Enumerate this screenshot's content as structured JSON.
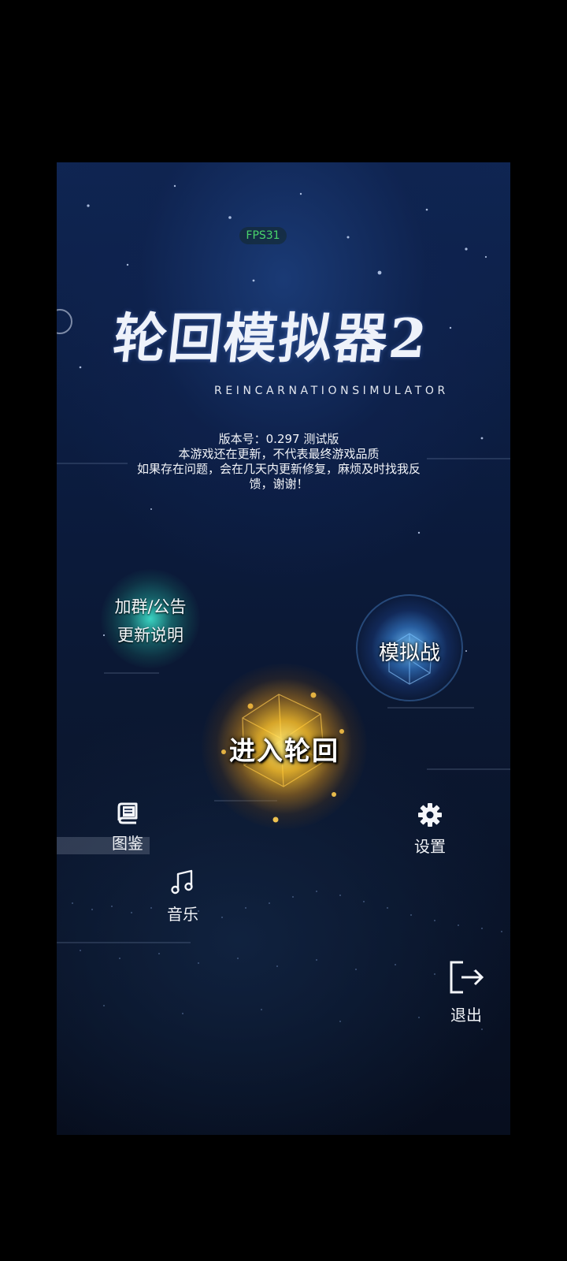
{
  "hud": {
    "fps": "FPS31"
  },
  "logo": {
    "title_cn": "轮回模拟器2",
    "title_en": "REINCARNATIONSIMULATOR"
  },
  "notice": {
    "version": "版本号：0.297 测试版",
    "line1": "本游戏还在更新，不代表最终游戏品质",
    "line2": "如果存在问题，会在几天内更新修复，麻烦及时找我反",
    "line3": "馈，谢谢！"
  },
  "menu": {
    "announce_line1": "加群/公告",
    "announce_line2": "更新说明",
    "battle": "模拟战",
    "enter": "进入轮回",
    "codex": "图鉴",
    "music": "音乐",
    "settings": "设置",
    "exit": "退出"
  },
  "icons": {
    "codex": "book-icon",
    "music": "music-note-icon",
    "settings": "gear-icon",
    "exit": "logout-icon"
  },
  "colors": {
    "fps_text": "#49d46b",
    "announce_orb": "#3cdcc8",
    "battle_orb": "#78c8ff",
    "enter_orb": "#fabe28"
  }
}
